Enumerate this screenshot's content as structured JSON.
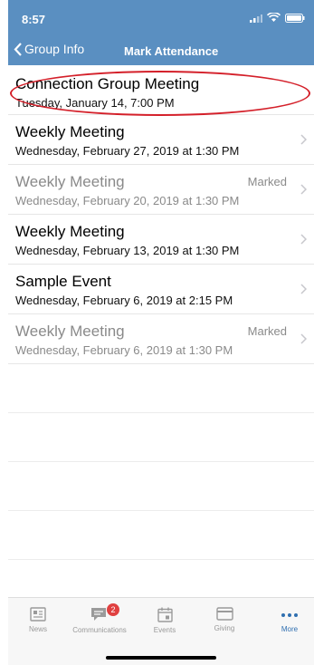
{
  "status_bar": {
    "time": "8:57"
  },
  "nav": {
    "back_label": "Group Info",
    "title": "Mark Attendance"
  },
  "events": [
    {
      "title": "Connection Group Meeting",
      "subtitle": "Tuesday, January 14, 7:00 PM",
      "status": ""
    },
    {
      "title": "Weekly Meeting",
      "subtitle": "Wednesday, February 27, 2019 at 1:30 PM",
      "status": ""
    },
    {
      "title": "Weekly Meeting",
      "subtitle": "Wednesday, February 20, 2019 at 1:30 PM",
      "status": "Marked"
    },
    {
      "title": "Weekly Meeting",
      "subtitle": "Wednesday, February 13, 2019 at 1:30 PM",
      "status": ""
    },
    {
      "title": "Sample Event",
      "subtitle": "Wednesday, February 6, 2019 at 2:15 PM",
      "status": ""
    },
    {
      "title": "Weekly Meeting",
      "subtitle": "Wednesday, February 6, 2019 at 1:30 PM",
      "status": "Marked"
    }
  ],
  "tabs": [
    {
      "label": "News",
      "icon": "news-icon"
    },
    {
      "label": "Communications",
      "icon": "chat-icon",
      "badge": "2"
    },
    {
      "label": "Events",
      "icon": "calendar-icon"
    },
    {
      "label": "Giving",
      "icon": "card-icon"
    },
    {
      "label": "More",
      "icon": "more-icon",
      "active": true
    }
  ],
  "colors": {
    "header": "#5a8fc1",
    "annotation": "#d4202a",
    "active_tab": "#2f6fb0",
    "badge": "#e04040"
  }
}
